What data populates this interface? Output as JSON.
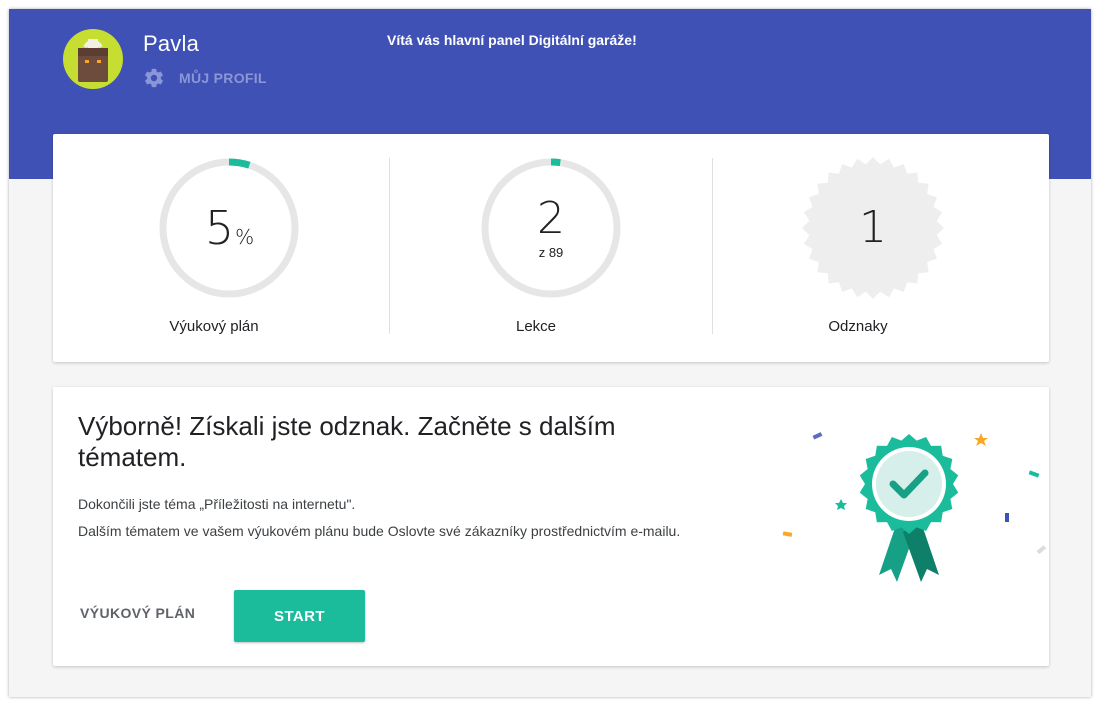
{
  "header": {
    "user_name": "Pavla",
    "profile_link": "MŮJ PROFIL",
    "welcome": "Vítá vás hlavní panel Digitální garáže!"
  },
  "stats": {
    "plan": {
      "value": "5",
      "unit": "%",
      "label": "Výukový plán",
      "progress": 0.05
    },
    "lessons": {
      "value": "2",
      "sub": "z 89",
      "label": "Lekce",
      "progress": 0.0225
    },
    "badges": {
      "value": "1",
      "label": "Odznaky"
    }
  },
  "main": {
    "heading": "Výborně! Získali jste odznak. Začněte s dalším tématem.",
    "paragraph_1": "Dokončili jste téma „Příležitosti na internetu\".",
    "paragraph_2": "Dalším tématem ve vašem výukovém plánu bude Oslovte své zákazníky prostřednictvím e-mailu.",
    "plan_button": "VÝUKOVÝ PLÁN",
    "start_button": "START"
  },
  "icons": {
    "avatar": "briefcase-avatar-icon",
    "profile": "gear-icon",
    "badge": "award-ribbon-icon"
  },
  "colors": {
    "hero": "#3f51b5",
    "accent": "#1abc9c",
    "avatar_bg": "#c6dd32",
    "ring_track": "#e6e6e6"
  }
}
